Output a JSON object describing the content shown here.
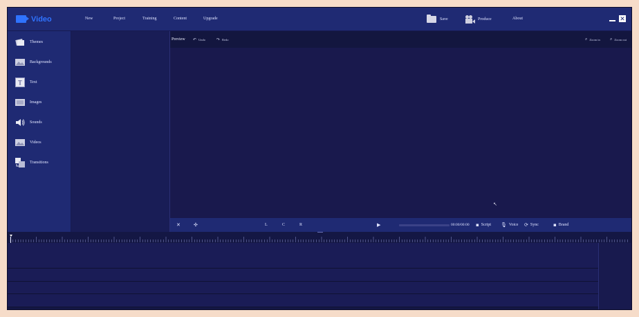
{
  "app": {
    "logo_text": "Video",
    "menu": [
      "New",
      "Project",
      "Training",
      "Content",
      "Upgrade"
    ],
    "save_label": "Save",
    "produce_label": "Produce",
    "about_label": "About"
  },
  "tools": [
    {
      "label": "Themes",
      "icon": "themes-icon"
    },
    {
      "label": "Backgrounds",
      "icon": "backgrounds-icon"
    },
    {
      "label": "Text",
      "icon": "text-icon"
    },
    {
      "label": "Images",
      "icon": "images-icon"
    },
    {
      "label": "Sounds",
      "icon": "speaker-icon"
    },
    {
      "label": "Videos",
      "icon": "videos-icon"
    },
    {
      "label": "Transitions",
      "icon": "transitions-icon"
    }
  ],
  "preview": {
    "title": "Preview",
    "undo_label": "Undo",
    "redo_label": "Redo",
    "zoom_in_label": "Zoom in",
    "zoom_out_label": "Zoom out"
  },
  "playbar": {
    "align_left": "L",
    "align_center": "C",
    "align_right": "R",
    "time": "00:00/00:00",
    "progress": 0,
    "script_label": "Script",
    "voice_label": "Voice",
    "sync_label": "Sync",
    "brand_label": "Brand"
  },
  "colors": {
    "accent": "#2f73ff",
    "topbar": "#1f2a73",
    "background": "#131345"
  }
}
